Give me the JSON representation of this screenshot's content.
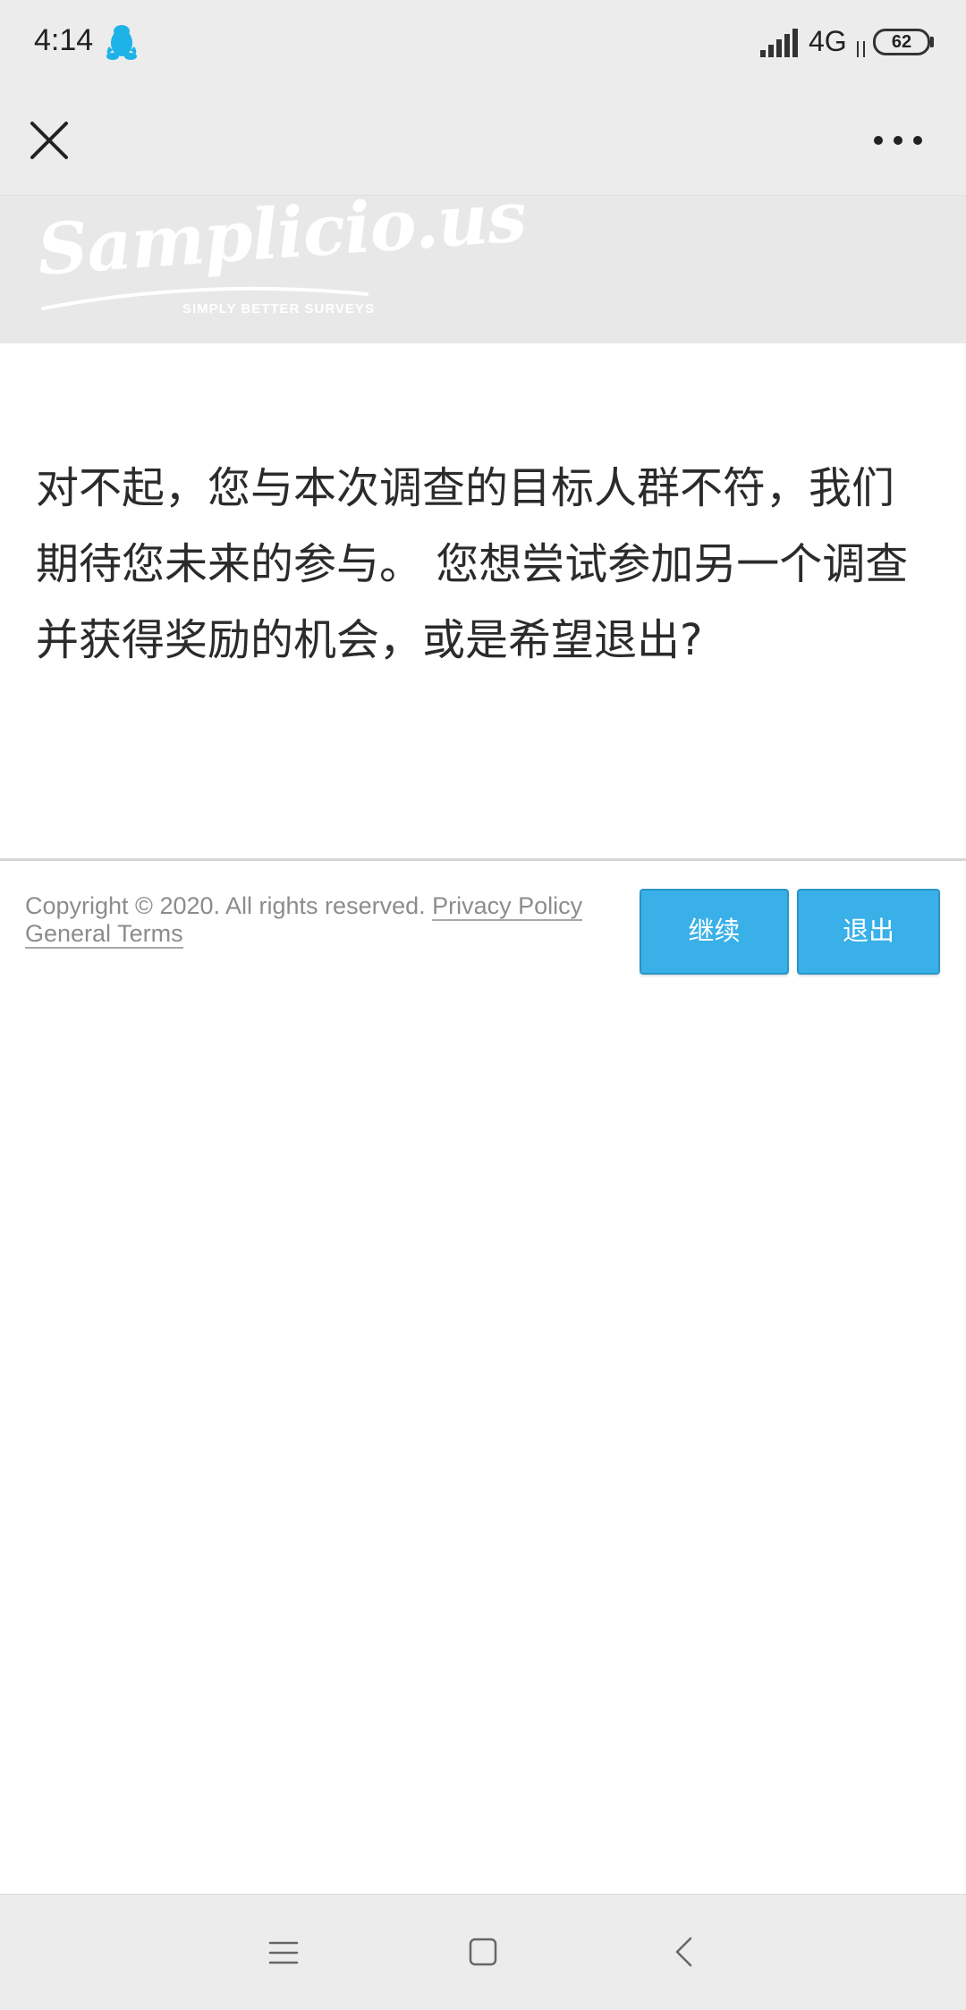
{
  "status_bar": {
    "time": "4:14",
    "network": "4G",
    "battery": "62",
    "qq_icon": "qq-penguin-icon",
    "qq_color": "#1db3e8",
    "signal_icon": "signal-bars-icon"
  },
  "app_bar": {
    "close_icon": "close-x-icon",
    "more_icon": "more-dots-icon"
  },
  "header": {
    "logo_text": "Samplicio.us",
    "tagline": "SIMPLY BETTER SURVEYS"
  },
  "content": {
    "message": "对不起，您与本次调查的目标人群不符，我们期待您未来的参与。 您想尝试参加另一个调查并获得奖励的机会，或是希望退出?"
  },
  "footer": {
    "copyright": "Copyright © 2020. All rights reserved. ",
    "privacy_link": "Privacy Policy",
    "terms_link": "General Terms",
    "continue_label": "继续",
    "exit_label": "退出",
    "button_color": "#39b0e8"
  },
  "nav_bar": {
    "menu_icon": "menu-lines-icon",
    "home_icon": "home-square-icon",
    "back_icon": "back-chevron-icon"
  }
}
